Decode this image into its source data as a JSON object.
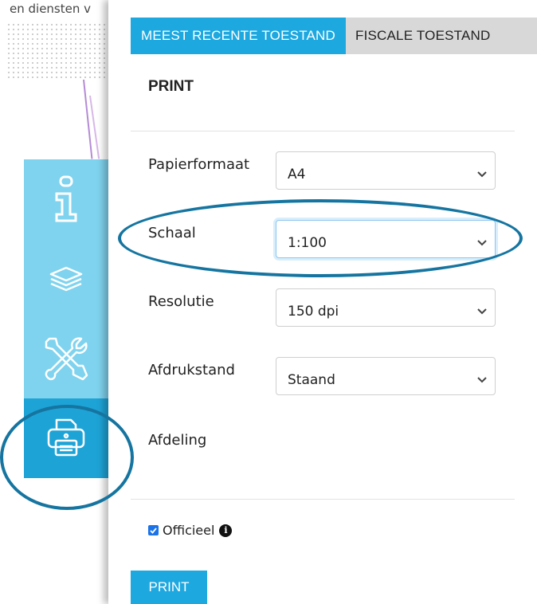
{
  "map": {
    "partial_text": "en diensten v"
  },
  "toolbar": {
    "items": [
      {
        "icon": "info-icon",
        "active": false
      },
      {
        "icon": "layers-icon",
        "active": false
      },
      {
        "icon": "tools-icon",
        "active": false
      },
      {
        "icon": "printer-icon",
        "active": true
      }
    ]
  },
  "tabs": [
    {
      "label": "MEEST RECENTE TOESTAND",
      "active": true
    },
    {
      "label": "FISCALE TOESTAND",
      "active": false
    }
  ],
  "panel": {
    "title": "PRINT",
    "fields": {
      "paper": {
        "label": "Papierformaat",
        "value": "A4"
      },
      "scale": {
        "label": "Schaal",
        "value": "1:100"
      },
      "resolution": {
        "label": "Resolutie",
        "value": "150 dpi"
      },
      "orientation": {
        "label": "Afdrukstand",
        "value": "Staand"
      },
      "department": {
        "label": "Afdeling"
      }
    },
    "official": {
      "label": "Officieel",
      "checked": true
    },
    "print_button": "PRINT"
  },
  "colors": {
    "accent": "#1ea8e0",
    "toolbar": "#7fd3ee",
    "annotation": "#1575a0"
  }
}
